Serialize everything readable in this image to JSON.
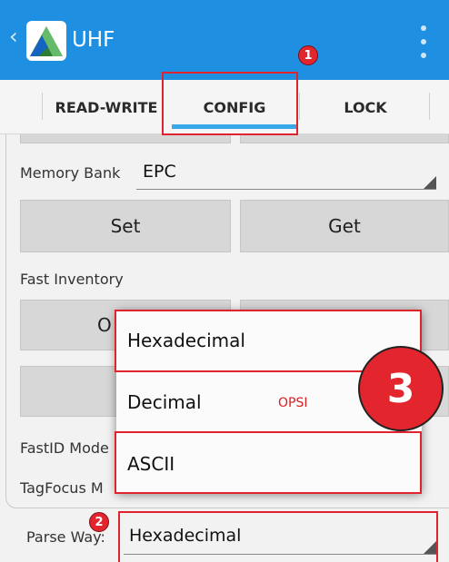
{
  "app": {
    "title": "UHF",
    "back_glyph": "‹"
  },
  "tabs": [
    {
      "label": "READ-WRITE"
    },
    {
      "label": "CONFIG"
    },
    {
      "label": "LOCK"
    }
  ],
  "config": {
    "memory_bank_label": "Memory Bank",
    "memory_bank_value": "EPC",
    "set_label": "Set",
    "get_label": "Get",
    "fast_inventory_label": "Fast Inventory",
    "partial_button_text": "O",
    "fastid_label": "FastID Mode",
    "tagfocus_label": "TagFocus M",
    "parse_way_label": "Parse Way:",
    "parse_way_value": "Hexadecimal"
  },
  "dropdown": {
    "options": [
      "Hexadecimal",
      "Decimal",
      "ASCII"
    ],
    "annotation": "OPSI"
  },
  "annotations": {
    "badge1": "1",
    "badge2": "2",
    "badge3": "3"
  },
  "colors": {
    "appbar": "#1e8fe1",
    "accent": "#38a8e8",
    "annotation_red": "#e0232e"
  }
}
